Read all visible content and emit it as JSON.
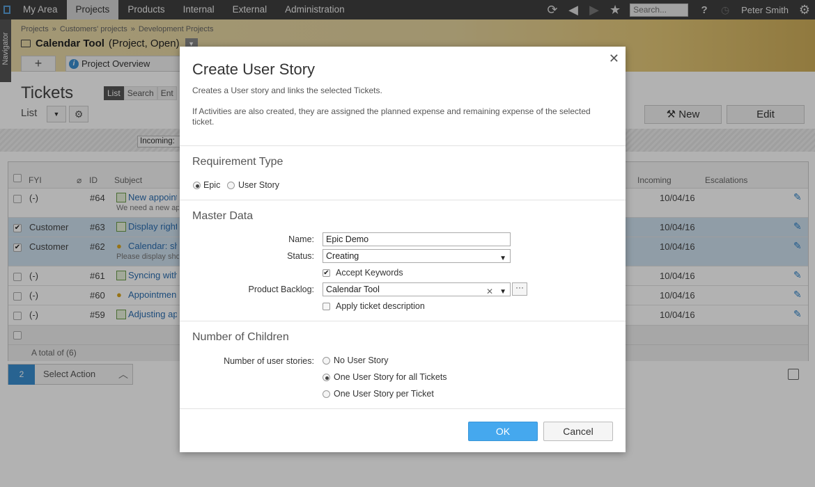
{
  "topnav": {
    "tabs": [
      "My Area",
      "Projects",
      "Products",
      "Internal",
      "External",
      "Administration"
    ],
    "search_placeholder": "Search...",
    "user": "Peter Smith"
  },
  "navigator_label": "Navigator",
  "header": {
    "breadcrumb": [
      "Projects",
      "Customers' projects",
      "Development Projects"
    ],
    "project_name": "Calendar Tool",
    "project_status": "(Project, Open)",
    "overview_tab": "Project Overview"
  },
  "tickets": {
    "title": "Tickets",
    "view_tabs": [
      "List",
      "Search",
      "Ent"
    ],
    "list_label": "List",
    "new_button": "New",
    "edit_button": "Edit",
    "incoming_filter": "Incoming:",
    "columns": {
      "fyi": "FYI",
      "id": "ID",
      "subject": "Subject",
      "incoming": "Incoming",
      "escalations": "Escalations"
    },
    "rows": [
      {
        "checked": false,
        "fyi": "(-)",
        "id": "#64",
        "subject": "New appointm",
        "sub2": "We need a new ap",
        "date": "10/04/16",
        "icon": "ticket"
      },
      {
        "checked": true,
        "fyi": "Customer",
        "id": "#63",
        "subject": "Display rights",
        "sub2": "",
        "date": "10/04/16",
        "icon": "ticket"
      },
      {
        "checked": true,
        "fyi": "Customer",
        "id": "#62",
        "subject": "Calendar: sho",
        "sub2": "Please display sho",
        "date": "10/04/16",
        "icon": "bulb"
      },
      {
        "checked": false,
        "fyi": "(-)",
        "id": "#61",
        "subject": "Syncing with",
        "sub2": "",
        "date": "10/04/16",
        "icon": "ticket"
      },
      {
        "checked": false,
        "fyi": "(-)",
        "id": "#60",
        "subject": "Appointmen",
        "sub2": "",
        "date": "10/04/16",
        "icon": "bulb"
      },
      {
        "checked": false,
        "fyi": "(-)",
        "id": "#59",
        "subject": "Adjusting app",
        "sub2": "",
        "date": "10/04/16",
        "icon": "ticket"
      }
    ],
    "total": "A total of (6)",
    "selected_count": "2",
    "select_action": "Select Action"
  },
  "modal": {
    "title": "Create User Story",
    "desc1": "Creates a User story and links the selected Tickets.",
    "desc2": "If Activities are also created, they are assigned the planned expense and remaining expense of the selected ticket.",
    "section_requirement": "Requirement Type",
    "req_epic": "Epic",
    "req_user_story": "User Story",
    "section_master": "Master Data",
    "name_label": "Name:",
    "name_value": "Epic Demo",
    "status_label": "Status:",
    "status_value": "Creating",
    "accept_keywords": "Accept Keywords",
    "product_backlog_label": "Product Backlog:",
    "product_backlog_value": "Calendar Tool",
    "apply_desc": "Apply ticket description",
    "section_children": "Number of Children",
    "num_stories_label": "Number of user stories:",
    "opt_none": "No User Story",
    "opt_one_all": "One User Story for all Tickets",
    "opt_one_per": "One User Story per Ticket",
    "ok": "OK",
    "cancel": "Cancel"
  }
}
